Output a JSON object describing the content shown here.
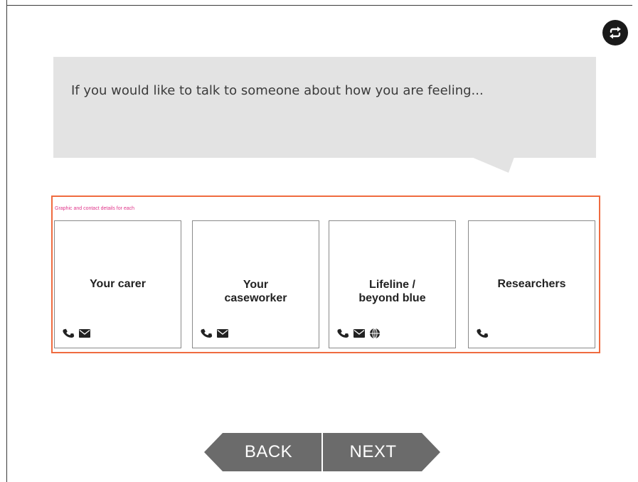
{
  "header": {
    "prompt": "If you would like to talk to someone about how you are feeling...",
    "toggle_icon": "repeat-icon"
  },
  "panel": {
    "note": "Graphic and contact details for each",
    "border_color": "#ef6b3f",
    "note_color": "#e0368a"
  },
  "cards": [
    {
      "title_lines": [
        "Your carer"
      ],
      "icons": [
        "phone-icon",
        "mail-icon"
      ]
    },
    {
      "title_lines": [
        "Your",
        "caseworker"
      ],
      "icons": [
        "phone-icon",
        "mail-icon"
      ]
    },
    {
      "title_lines": [
        "Lifeline /",
        "beyond blue"
      ],
      "icons": [
        "phone-icon",
        "mail-icon",
        "globe-icon"
      ]
    },
    {
      "title_lines": [
        "Researchers"
      ],
      "icons": [
        "phone-icon"
      ]
    }
  ],
  "nav": {
    "back_label": "BACK",
    "next_label": "NEXT",
    "button_color": "#6b6b6b"
  }
}
